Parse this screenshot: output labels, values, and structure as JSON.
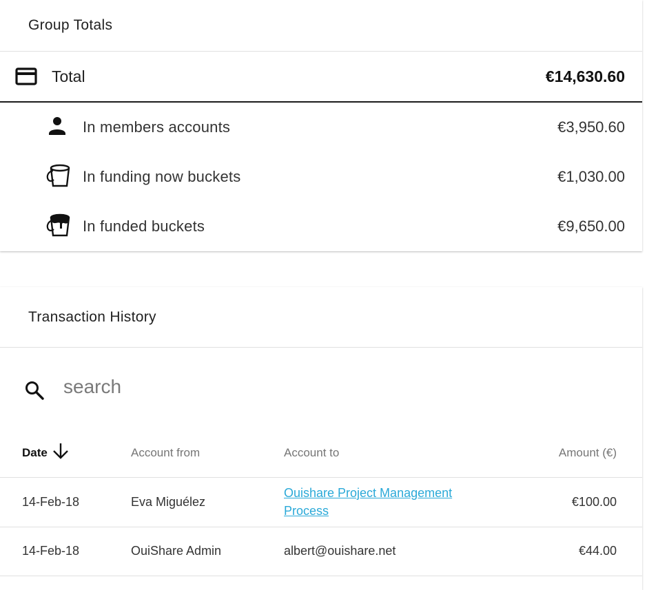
{
  "totals": {
    "header": "Group Totals",
    "total": {
      "label": "Total",
      "amount": "€14,630.60",
      "icon": "credit-card-icon"
    },
    "rows": [
      {
        "label": "In members accounts",
        "amount": "€3,950.60",
        "icon": "person-icon"
      },
      {
        "label": "In funding now buckets",
        "amount": "€1,030.00",
        "icon": "bucket-empty-icon"
      },
      {
        "label": "In funded buckets",
        "amount": "€9,650.00",
        "icon": "bucket-filled-icon"
      }
    ]
  },
  "history": {
    "header": "Transaction History",
    "search": {
      "placeholder": "search",
      "value": ""
    },
    "columns": {
      "date": "Date",
      "from": "Account from",
      "to": "Account to",
      "amount": "Amount (€)"
    },
    "rows": [
      {
        "date": "14-Feb-18",
        "from": "Eva Miguélez",
        "to": "Ouishare Project Management Process",
        "to_is_link": true,
        "amount": "€100.00"
      },
      {
        "date": "14-Feb-18",
        "from": "OuiShare Admin",
        "to": "albert@ouishare.net",
        "to_is_link": false,
        "amount": "€44.00"
      }
    ]
  },
  "colors": {
    "link": "#2aa9d8",
    "text": "#212121"
  }
}
